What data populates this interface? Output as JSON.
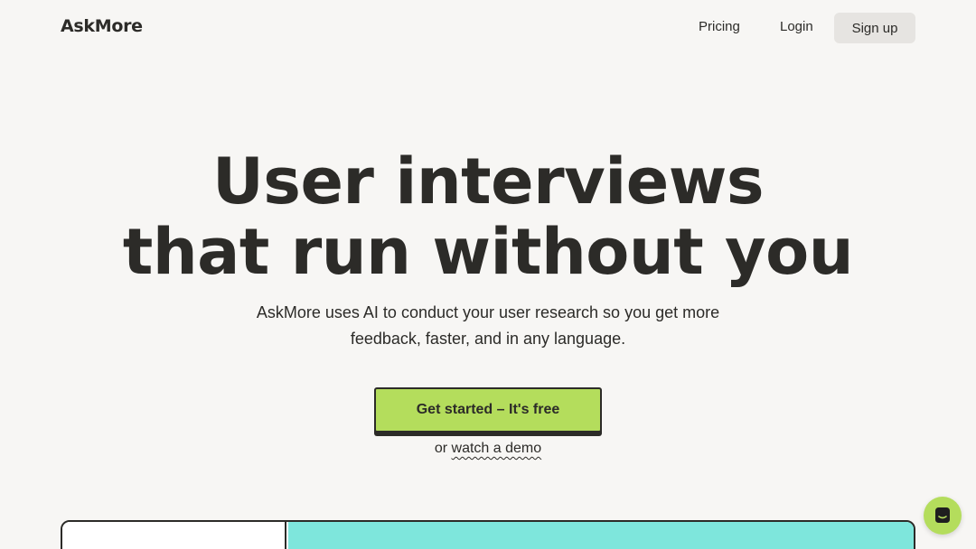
{
  "nav": {
    "logo": "AskMore",
    "links": [
      {
        "label": "Pricing"
      },
      {
        "label": "Login"
      }
    ],
    "signup_label": "Sign up"
  },
  "hero": {
    "title_line1": "User interviews",
    "title_line2": "that run without you",
    "subtitle_line1": "AskMore uses AI to conduct your user research so you get more",
    "subtitle_line2": "feedback, faster, and in any language.",
    "cta_label": "Get started – It's free",
    "demo_prefix": "or ",
    "demo_link": "watch a demo"
  },
  "chat": {
    "icon": "chat-bubble-icon"
  },
  "colors": {
    "background": "#f7f6f4",
    "text": "#2c2b28",
    "accent": "#b4dd5c",
    "signup_bg": "#e6e4e1",
    "preview_teal": "#7ee6dc"
  }
}
